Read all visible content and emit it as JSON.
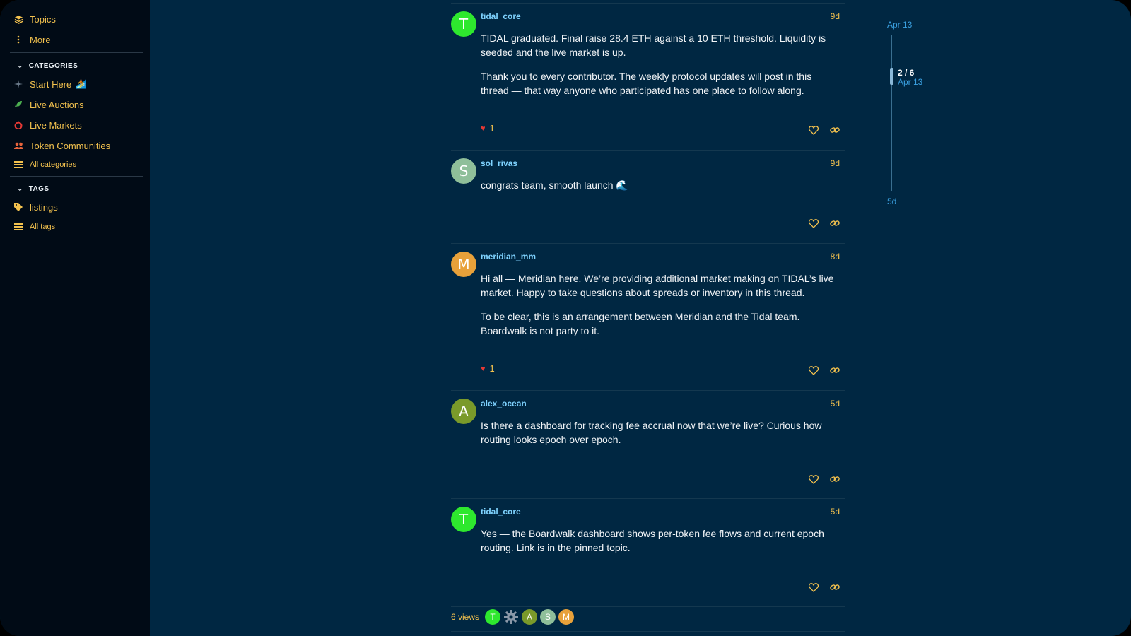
{
  "sidebar": {
    "topics_label": "Topics",
    "more_label": "More",
    "categories_header": "CATEGORIES",
    "categories": [
      {
        "label": "Start Here",
        "icon": "sparkle-icon",
        "color": "#6c7c8c"
      },
      {
        "label": "Live Auctions",
        "icon": "rocket-icon",
        "color": "#4caf50"
      },
      {
        "label": "Live Markets",
        "icon": "fire-icon",
        "color": "#e53935"
      },
      {
        "label": "Token Communities",
        "icon": "users-icon",
        "color": "#e8643c"
      }
    ],
    "start_here_emoji": "🏄",
    "all_categories_label": "All categories",
    "tags_header": "TAGS",
    "tags": [
      {
        "label": "listings",
        "icon": "tag-icon"
      }
    ],
    "all_tags_label": "All tags"
  },
  "posts": [
    {
      "username": "tidal_core",
      "avatar_letter": "T",
      "avatar_color": "#2ee82e",
      "age": "9d",
      "paragraphs": [
        "TIDAL graduated. Final raise 28.4 ETH against a 10 ETH threshold. Liquidity is seeded and the live market is up.",
        "Thank you to every contributor. The weekly protocol updates will post in this thread — that way anyone who participated has one place to follow along."
      ],
      "likes": "1"
    },
    {
      "username": "sol_rivas",
      "avatar_letter": "S",
      "avatar_color": "#8fbf9a",
      "age": "9d",
      "paragraphs": [
        "congrats team, smooth launch 🌊"
      ],
      "likes": ""
    },
    {
      "username": "meridian_mm",
      "avatar_letter": "M",
      "avatar_color": "#e8a13a",
      "age": "8d",
      "paragraphs": [
        "Hi all — Meridian here. We’re providing additional market making on TIDAL’s live market. Happy to take questions about spreads or inventory in this thread.",
        "To be clear, this is an arrangement between Meridian and the Tidal team. Boardwalk is not party to it."
      ],
      "likes": "1"
    },
    {
      "username": "alex_ocean",
      "avatar_letter": "A",
      "avatar_color": "#7a9a2a",
      "age": "5d",
      "paragraphs": [
        "Is there a dashboard for tracking fee accrual now that we’re live? Curious how routing looks epoch over epoch."
      ],
      "likes": ""
    },
    {
      "username": "tidal_core",
      "avatar_letter": "T",
      "avatar_color": "#2ee82e",
      "age": "5d",
      "paragraphs": [
        "Yes — the Boardwalk dashboard shows per-token fee flows and current epoch routing. Link is in the pinned topic."
      ],
      "likes": ""
    }
  ],
  "footer": {
    "views": "6 views",
    "participants": [
      {
        "letter": "T",
        "color": "#2ee82e"
      },
      {
        "letter": "",
        "icon": "gear-icon",
        "color": "#8a98a8"
      },
      {
        "letter": "A",
        "color": "#7a9a2a"
      },
      {
        "letter": "S",
        "color": "#8fbf9a"
      },
      {
        "letter": "M",
        "color": "#e8a13a"
      }
    ]
  },
  "timeline": {
    "start_date": "Apr 13",
    "position": "2 / 6",
    "position_date": "Apr 13",
    "end_date": "5d",
    "progress": 0.333
  },
  "colors": {
    "accent": "#f2c14e",
    "username": "#7fd3ff",
    "background": "#002742",
    "sidebar": "#010b16"
  }
}
